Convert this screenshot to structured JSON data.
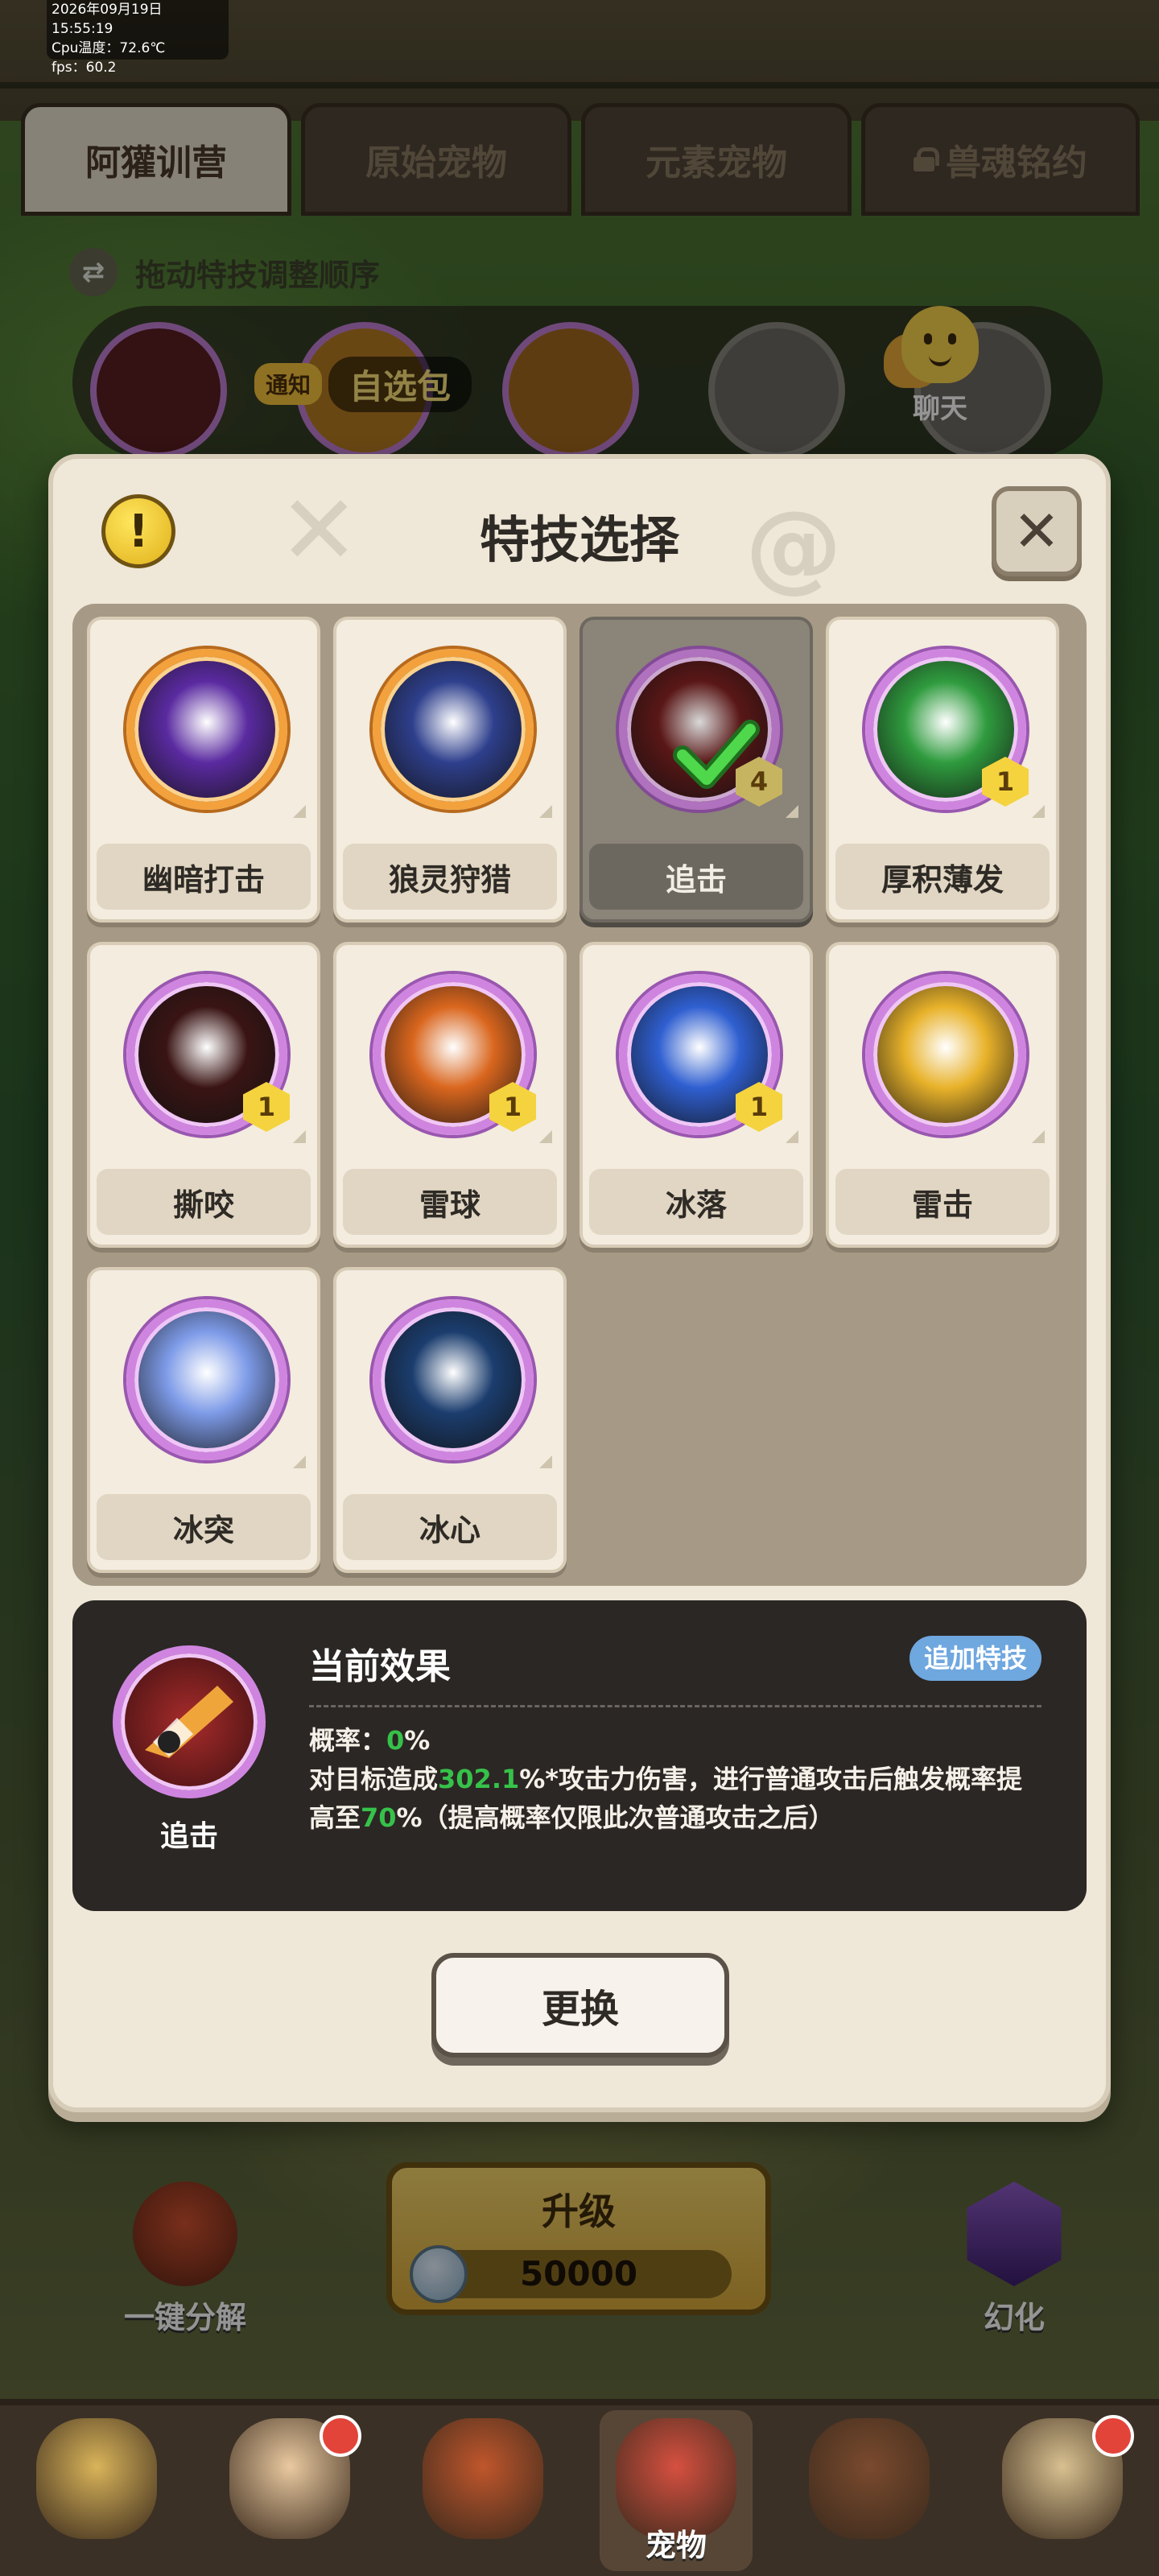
{
  "debug": {
    "datetime": "2026年09月19日 15:55:19",
    "cpu": "Cpu温度：72.6℃",
    "fps": "fps：60.2"
  },
  "tabs": [
    {
      "label": "阿獾训营",
      "active": true
    },
    {
      "label": "原始宠物",
      "active": false
    },
    {
      "label": "元素宠物",
      "active": false
    },
    {
      "label": "兽魂铭约",
      "active": false,
      "locked": true
    }
  ],
  "hint": "拖动特技调整顺序",
  "notice": {
    "badge": "通知",
    "text": "自选包"
  },
  "chat": {
    "label": "聊天"
  },
  "modal": {
    "title": "特技选择",
    "info_icon": "exclamation-icon",
    "close_icon": "close-icon"
  },
  "skills": [
    {
      "name": "幽暗打击",
      "level": null,
      "selected": false,
      "ring": "orange",
      "color": "#5a2aa0"
    },
    {
      "name": "狼灵狩猎",
      "level": null,
      "selected": false,
      "ring": "orange",
      "color": "#2e3f8c"
    },
    {
      "name": "追击",
      "level": "4",
      "selected": true,
      "ring": "purple",
      "color": "#6a1b1b"
    },
    {
      "name": "厚积薄发",
      "level": "1",
      "selected": false,
      "ring": "purple",
      "color": "#2f9b3e"
    },
    {
      "name": "撕咬",
      "level": "1",
      "selected": false,
      "ring": "purple",
      "color": "#3a1414"
    },
    {
      "name": "雷球",
      "level": "1",
      "selected": false,
      "ring": "purple",
      "color": "#d9661e"
    },
    {
      "name": "冰落",
      "level": "1",
      "selected": false,
      "ring": "purple",
      "color": "#2f5fd0"
    },
    {
      "name": "雷击",
      "level": null,
      "selected": false,
      "ring": "purple",
      "color": "#e8b22a"
    },
    {
      "name": "冰突",
      "level": null,
      "selected": false,
      "ring": "purple",
      "color": "#7e9be8"
    },
    {
      "name": "冰心",
      "level": null,
      "selected": false,
      "ring": "purple",
      "color": "#1b3d6e"
    }
  ],
  "effect": {
    "skill_name": "追击",
    "title": "当前效果",
    "add_button": "追加特技",
    "line1_prefix": "概率：",
    "line1_value": "0",
    "line1_suffix": "%",
    "line2_prefix": "对目标造成",
    "line2_value": "302.1",
    "line2_mid": "%*攻击力伤害，进行普通攻击后触发概率提高至",
    "line2_value2": "70",
    "line2_suffix": "%（提高概率仅限此次普通攻击之后）"
  },
  "change_button": "更换",
  "upgrade": {
    "label": "升级",
    "cost": "50000"
  },
  "side_left": "一键分解",
  "side_right": "幻化",
  "nav": [
    {
      "label": "",
      "active": false,
      "dot": false,
      "color": "#d9b45a"
    },
    {
      "label": "",
      "active": false,
      "dot": true,
      "color": "#e9c9a0"
    },
    {
      "label": "",
      "active": false,
      "dot": false,
      "color": "#c0562c"
    },
    {
      "label": "宠物",
      "active": true,
      "dot": false,
      "color": "#d65040"
    },
    {
      "label": "",
      "active": false,
      "dot": false,
      "color": "#7a4a2e"
    },
    {
      "label": "",
      "active": false,
      "dot": true,
      "color": "#d8c090"
    }
  ]
}
